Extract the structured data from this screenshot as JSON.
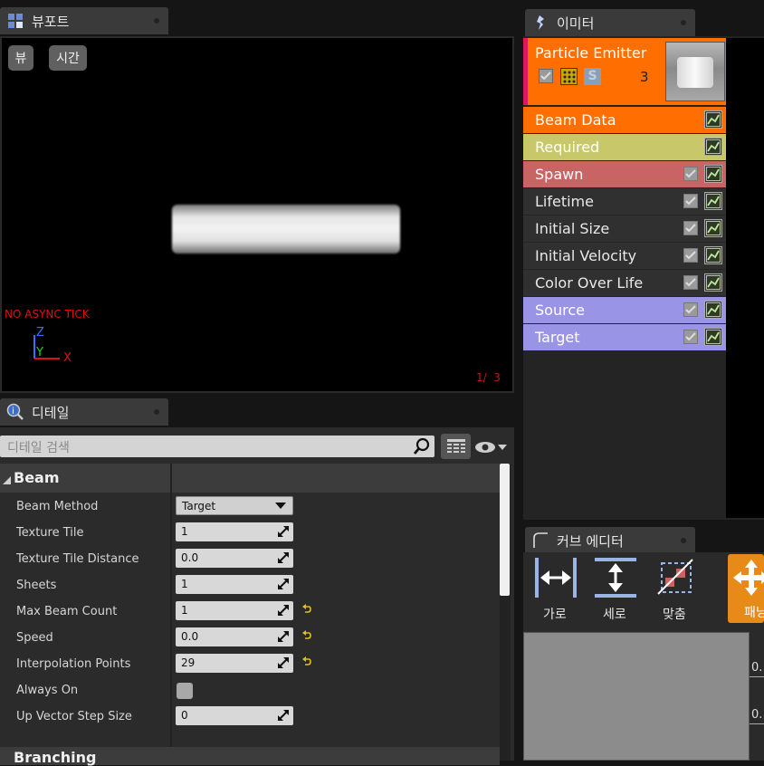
{
  "viewport": {
    "tab_title": "뷰포트",
    "btn_view": "뷰",
    "btn_time": "시간",
    "warning": "NO ASYNC TICK",
    "axis_z": "Z",
    "axis_y": "Y",
    "axis_x": "X",
    "counter": "1/  3"
  },
  "emitter": {
    "tab_title": "이미터",
    "name": "Particle Emitter",
    "solo": "S",
    "count": "3",
    "modules": [
      {
        "label": "Beam Data",
        "color": "#ff6e00",
        "checkbox": false
      },
      {
        "label": "Required",
        "color": "#c8c86a",
        "checkbox": false
      },
      {
        "label": "Spawn",
        "color": "#c86464",
        "checkbox": true
      },
      {
        "label": "Lifetime",
        "color": "#303030",
        "checkbox": true
      },
      {
        "label": "Initial Size",
        "color": "#303030",
        "checkbox": true
      },
      {
        "label": "Initial Velocity",
        "color": "#303030",
        "checkbox": true
      },
      {
        "label": "Color Over Life",
        "color": "#303030",
        "checkbox": true
      },
      {
        "label": "Source",
        "color": "#9a94e6",
        "checkbox": true
      },
      {
        "label": "Target",
        "color": "#9a94e6",
        "checkbox": true
      }
    ]
  },
  "details": {
    "tab_title": "디테일",
    "search_placeholder": "디테일 검색",
    "section": "Beam",
    "next_section": "Branching",
    "rows": [
      {
        "label": "Beam Method",
        "value": "Target",
        "type": "dropdown",
        "reset": false
      },
      {
        "label": "Texture Tile",
        "value": "1",
        "type": "number",
        "reset": false
      },
      {
        "label": "Texture Tile Distance",
        "value": "0.0",
        "type": "number",
        "reset": false
      },
      {
        "label": "Sheets",
        "value": "1",
        "type": "number",
        "reset": false
      },
      {
        "label": "Max Beam Count",
        "value": "1",
        "type": "number",
        "reset": true
      },
      {
        "label": "Speed",
        "value": "0.0",
        "type": "number",
        "reset": true
      },
      {
        "label": "Interpolation Points",
        "value": "29",
        "type": "number",
        "reset": true
      },
      {
        "label": "Always On",
        "value": "",
        "type": "checkbox",
        "reset": false
      },
      {
        "label": "Up Vector Step Size",
        "value": "0",
        "type": "number",
        "reset": false
      }
    ]
  },
  "curve_editor": {
    "tab_title": "커브 에디터",
    "btn_horizontal": "가로",
    "btn_vertical": "세로",
    "btn_fit": "맞춤",
    "btn_pan": "패닝",
    "axis_labels": [
      "0.",
      "0."
    ]
  },
  "colors": {
    "accent_orange": "#ff6e00",
    "required_yellow": "#c8c86a",
    "spawn_red": "#c86464",
    "source_purple": "#9a94e6"
  }
}
